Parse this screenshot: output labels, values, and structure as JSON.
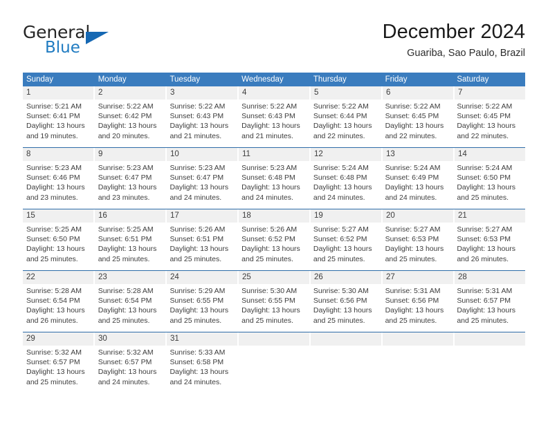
{
  "logo": {
    "word_general": "General",
    "word_blue": "Blue",
    "flag_icon": "triangle-flag-icon",
    "accent_color": "#1668b3"
  },
  "header": {
    "month_title": "December 2024",
    "location": "Guariba, Sao Paulo, Brazil"
  },
  "calendar": {
    "header_bg": "#3a7cbe",
    "daynum_bg": "#f0f0f0",
    "separator_color": "#2d6ca8",
    "weekdays": [
      "Sunday",
      "Monday",
      "Tuesday",
      "Wednesday",
      "Thursday",
      "Friday",
      "Saturday"
    ],
    "weeks": [
      [
        {
          "day": "1",
          "sunrise": "Sunrise: 5:21 AM",
          "sunset": "Sunset: 6:41 PM",
          "daylight_line1": "Daylight: 13 hours",
          "daylight_line2": "and 19 minutes."
        },
        {
          "day": "2",
          "sunrise": "Sunrise: 5:22 AM",
          "sunset": "Sunset: 6:42 PM",
          "daylight_line1": "Daylight: 13 hours",
          "daylight_line2": "and 20 minutes."
        },
        {
          "day": "3",
          "sunrise": "Sunrise: 5:22 AM",
          "sunset": "Sunset: 6:43 PM",
          "daylight_line1": "Daylight: 13 hours",
          "daylight_line2": "and 21 minutes."
        },
        {
          "day": "4",
          "sunrise": "Sunrise: 5:22 AM",
          "sunset": "Sunset: 6:43 PM",
          "daylight_line1": "Daylight: 13 hours",
          "daylight_line2": "and 21 minutes."
        },
        {
          "day": "5",
          "sunrise": "Sunrise: 5:22 AM",
          "sunset": "Sunset: 6:44 PM",
          "daylight_line1": "Daylight: 13 hours",
          "daylight_line2": "and 22 minutes."
        },
        {
          "day": "6",
          "sunrise": "Sunrise: 5:22 AM",
          "sunset": "Sunset: 6:45 PM",
          "daylight_line1": "Daylight: 13 hours",
          "daylight_line2": "and 22 minutes."
        },
        {
          "day": "7",
          "sunrise": "Sunrise: 5:22 AM",
          "sunset": "Sunset: 6:45 PM",
          "daylight_line1": "Daylight: 13 hours",
          "daylight_line2": "and 22 minutes."
        }
      ],
      [
        {
          "day": "8",
          "sunrise": "Sunrise: 5:23 AM",
          "sunset": "Sunset: 6:46 PM",
          "daylight_line1": "Daylight: 13 hours",
          "daylight_line2": "and 23 minutes."
        },
        {
          "day": "9",
          "sunrise": "Sunrise: 5:23 AM",
          "sunset": "Sunset: 6:47 PM",
          "daylight_line1": "Daylight: 13 hours",
          "daylight_line2": "and 23 minutes."
        },
        {
          "day": "10",
          "sunrise": "Sunrise: 5:23 AM",
          "sunset": "Sunset: 6:47 PM",
          "daylight_line1": "Daylight: 13 hours",
          "daylight_line2": "and 24 minutes."
        },
        {
          "day": "11",
          "sunrise": "Sunrise: 5:23 AM",
          "sunset": "Sunset: 6:48 PM",
          "daylight_line1": "Daylight: 13 hours",
          "daylight_line2": "and 24 minutes."
        },
        {
          "day": "12",
          "sunrise": "Sunrise: 5:24 AM",
          "sunset": "Sunset: 6:48 PM",
          "daylight_line1": "Daylight: 13 hours",
          "daylight_line2": "and 24 minutes."
        },
        {
          "day": "13",
          "sunrise": "Sunrise: 5:24 AM",
          "sunset": "Sunset: 6:49 PM",
          "daylight_line1": "Daylight: 13 hours",
          "daylight_line2": "and 24 minutes."
        },
        {
          "day": "14",
          "sunrise": "Sunrise: 5:24 AM",
          "sunset": "Sunset: 6:50 PM",
          "daylight_line1": "Daylight: 13 hours",
          "daylight_line2": "and 25 minutes."
        }
      ],
      [
        {
          "day": "15",
          "sunrise": "Sunrise: 5:25 AM",
          "sunset": "Sunset: 6:50 PM",
          "daylight_line1": "Daylight: 13 hours",
          "daylight_line2": "and 25 minutes."
        },
        {
          "day": "16",
          "sunrise": "Sunrise: 5:25 AM",
          "sunset": "Sunset: 6:51 PM",
          "daylight_line1": "Daylight: 13 hours",
          "daylight_line2": "and 25 minutes."
        },
        {
          "day": "17",
          "sunrise": "Sunrise: 5:26 AM",
          "sunset": "Sunset: 6:51 PM",
          "daylight_line1": "Daylight: 13 hours",
          "daylight_line2": "and 25 minutes."
        },
        {
          "day": "18",
          "sunrise": "Sunrise: 5:26 AM",
          "sunset": "Sunset: 6:52 PM",
          "daylight_line1": "Daylight: 13 hours",
          "daylight_line2": "and 25 minutes."
        },
        {
          "day": "19",
          "sunrise": "Sunrise: 5:27 AM",
          "sunset": "Sunset: 6:52 PM",
          "daylight_line1": "Daylight: 13 hours",
          "daylight_line2": "and 25 minutes."
        },
        {
          "day": "20",
          "sunrise": "Sunrise: 5:27 AM",
          "sunset": "Sunset: 6:53 PM",
          "daylight_line1": "Daylight: 13 hours",
          "daylight_line2": "and 25 minutes."
        },
        {
          "day": "21",
          "sunrise": "Sunrise: 5:27 AM",
          "sunset": "Sunset: 6:53 PM",
          "daylight_line1": "Daylight: 13 hours",
          "daylight_line2": "and 26 minutes."
        }
      ],
      [
        {
          "day": "22",
          "sunrise": "Sunrise: 5:28 AM",
          "sunset": "Sunset: 6:54 PM",
          "daylight_line1": "Daylight: 13 hours",
          "daylight_line2": "and 26 minutes."
        },
        {
          "day": "23",
          "sunrise": "Sunrise: 5:28 AM",
          "sunset": "Sunset: 6:54 PM",
          "daylight_line1": "Daylight: 13 hours",
          "daylight_line2": "and 25 minutes."
        },
        {
          "day": "24",
          "sunrise": "Sunrise: 5:29 AM",
          "sunset": "Sunset: 6:55 PM",
          "daylight_line1": "Daylight: 13 hours",
          "daylight_line2": "and 25 minutes."
        },
        {
          "day": "25",
          "sunrise": "Sunrise: 5:30 AM",
          "sunset": "Sunset: 6:55 PM",
          "daylight_line1": "Daylight: 13 hours",
          "daylight_line2": "and 25 minutes."
        },
        {
          "day": "26",
          "sunrise": "Sunrise: 5:30 AM",
          "sunset": "Sunset: 6:56 PM",
          "daylight_line1": "Daylight: 13 hours",
          "daylight_line2": "and 25 minutes."
        },
        {
          "day": "27",
          "sunrise": "Sunrise: 5:31 AM",
          "sunset": "Sunset: 6:56 PM",
          "daylight_line1": "Daylight: 13 hours",
          "daylight_line2": "and 25 minutes."
        },
        {
          "day": "28",
          "sunrise": "Sunrise: 5:31 AM",
          "sunset": "Sunset: 6:57 PM",
          "daylight_line1": "Daylight: 13 hours",
          "daylight_line2": "and 25 minutes."
        }
      ],
      [
        {
          "day": "29",
          "sunrise": "Sunrise: 5:32 AM",
          "sunset": "Sunset: 6:57 PM",
          "daylight_line1": "Daylight: 13 hours",
          "daylight_line2": "and 25 minutes."
        },
        {
          "day": "30",
          "sunrise": "Sunrise: 5:32 AM",
          "sunset": "Sunset: 6:57 PM",
          "daylight_line1": "Daylight: 13 hours",
          "daylight_line2": "and 24 minutes."
        },
        {
          "day": "31",
          "sunrise": "Sunrise: 5:33 AM",
          "sunset": "Sunset: 6:58 PM",
          "daylight_line1": "Daylight: 13 hours",
          "daylight_line2": "and 24 minutes."
        },
        {
          "day": "",
          "sunrise": "",
          "sunset": "",
          "daylight_line1": "",
          "daylight_line2": ""
        },
        {
          "day": "",
          "sunrise": "",
          "sunset": "",
          "daylight_line1": "",
          "daylight_line2": ""
        },
        {
          "day": "",
          "sunrise": "",
          "sunset": "",
          "daylight_line1": "",
          "daylight_line2": ""
        },
        {
          "day": "",
          "sunrise": "",
          "sunset": "",
          "daylight_line1": "",
          "daylight_line2": ""
        }
      ]
    ]
  }
}
